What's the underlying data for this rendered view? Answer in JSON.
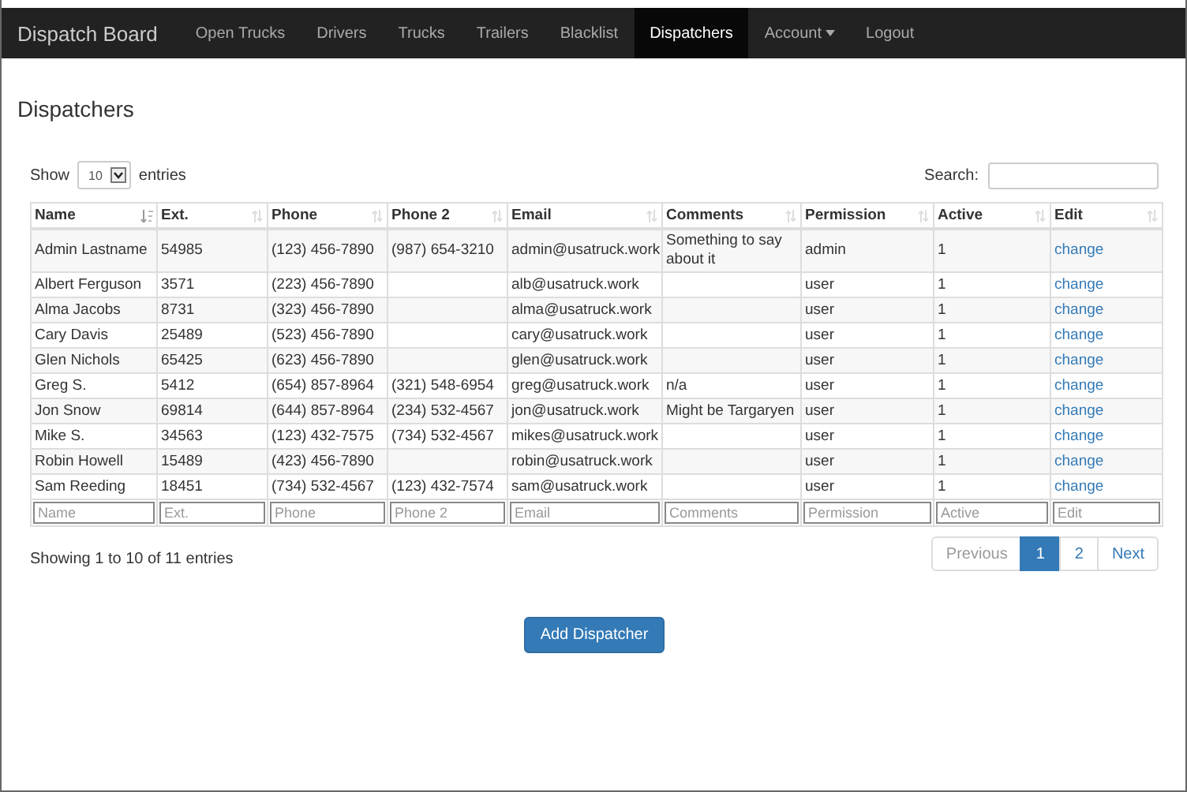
{
  "navbar": {
    "brand": "Dispatch Board",
    "items": [
      {
        "label": "Open Trucks",
        "selected": false,
        "dropdown": false
      },
      {
        "label": "Drivers",
        "selected": false,
        "dropdown": false
      },
      {
        "label": "Trucks",
        "selected": false,
        "dropdown": false
      },
      {
        "label": "Trailers",
        "selected": false,
        "dropdown": false
      },
      {
        "label": "Blacklist",
        "selected": false,
        "dropdown": false
      },
      {
        "label": "Dispatchers",
        "selected": true,
        "dropdown": false
      },
      {
        "label": "Account",
        "selected": false,
        "dropdown": true
      },
      {
        "label": "Logout",
        "selected": false,
        "dropdown": false
      }
    ]
  },
  "page_title": "Dispatchers",
  "length_control": {
    "before": "Show",
    "value": "10",
    "after": "entries"
  },
  "search": {
    "label": "Search:"
  },
  "table": {
    "columns": [
      {
        "label": "Name",
        "sorted": true,
        "filter_placeholder": "Name"
      },
      {
        "label": "Ext.",
        "sorted": false,
        "filter_placeholder": "Ext."
      },
      {
        "label": "Phone",
        "sorted": false,
        "filter_placeholder": "Phone"
      },
      {
        "label": "Phone 2",
        "sorted": false,
        "filter_placeholder": "Phone 2"
      },
      {
        "label": "Email",
        "sorted": false,
        "filter_placeholder": "Email"
      },
      {
        "label": "Comments",
        "sorted": false,
        "filter_placeholder": "Comments"
      },
      {
        "label": "Permission",
        "sorted": false,
        "filter_placeholder": "Permission"
      },
      {
        "label": "Active",
        "sorted": false,
        "filter_placeholder": "Active"
      },
      {
        "label": "Edit",
        "sorted": false,
        "filter_placeholder": "Edit"
      }
    ],
    "rows": [
      {
        "name": "Admin Lastname",
        "ext": "54985",
        "phone": "(123) 456-7890",
        "phone2": "(987) 654-3210",
        "email": "admin@usatruck.work",
        "comments": "Something to say about it",
        "permission": "admin",
        "active": "1",
        "edit": "change"
      },
      {
        "name": "Albert Ferguson",
        "ext": "3571",
        "phone": "(223) 456-7890",
        "phone2": "",
        "email": "alb@usatruck.work",
        "comments": "",
        "permission": "user",
        "active": "1",
        "edit": "change"
      },
      {
        "name": "Alma Jacobs",
        "ext": "8731",
        "phone": "(323) 456-7890",
        "phone2": "",
        "email": "alma@usatruck.work",
        "comments": "",
        "permission": "user",
        "active": "1",
        "edit": "change"
      },
      {
        "name": "Cary Davis",
        "ext": "25489",
        "phone": "(523) 456-7890",
        "phone2": "",
        "email": "cary@usatruck.work",
        "comments": "",
        "permission": "user",
        "active": "1",
        "edit": "change"
      },
      {
        "name": "Glen Nichols",
        "ext": "65425",
        "phone": "(623) 456-7890",
        "phone2": "",
        "email": "glen@usatruck.work",
        "comments": "",
        "permission": "user",
        "active": "1",
        "edit": "change"
      },
      {
        "name": "Greg S.",
        "ext": "5412",
        "phone": "(654) 857-8964",
        "phone2": "(321) 548-6954",
        "email": "greg@usatruck.work",
        "comments": "n/a",
        "permission": "user",
        "active": "1",
        "edit": "change"
      },
      {
        "name": "Jon Snow",
        "ext": "69814",
        "phone": "(644) 857-8964",
        "phone2": "(234) 532-4567",
        "email": "jon@usatruck.work",
        "comments": "Might be Targaryen",
        "permission": "user",
        "active": "1",
        "edit": "change"
      },
      {
        "name": "Mike S.",
        "ext": "34563",
        "phone": "(123) 432-7575",
        "phone2": "(734) 532-4567",
        "email": "mikes@usatruck.work",
        "comments": "",
        "permission": "user",
        "active": "1",
        "edit": "change"
      },
      {
        "name": "Robin Howell",
        "ext": "15489",
        "phone": "(423) 456-7890",
        "phone2": "",
        "email": "robin@usatruck.work",
        "comments": "",
        "permission": "user",
        "active": "1",
        "edit": "change"
      },
      {
        "name": "Sam Reeding",
        "ext": "18451",
        "phone": "(734) 532-4567",
        "phone2": "(123) 432-7574",
        "email": "sam@usatruck.work",
        "comments": "",
        "permission": "user",
        "active": "1",
        "edit": "change"
      }
    ]
  },
  "info": "Showing 1 to 10 of 11 entries",
  "pagination": [
    {
      "label": "Previous",
      "kind": "prev",
      "disabled": true,
      "selected": false
    },
    {
      "label": "1",
      "kind": "page",
      "disabled": false,
      "selected": true
    },
    {
      "label": "2",
      "kind": "page",
      "disabled": false,
      "selected": false
    },
    {
      "label": "Next",
      "kind": "next",
      "disabled": false,
      "selected": false
    }
  ],
  "add_button": "Add Dispatcher"
}
